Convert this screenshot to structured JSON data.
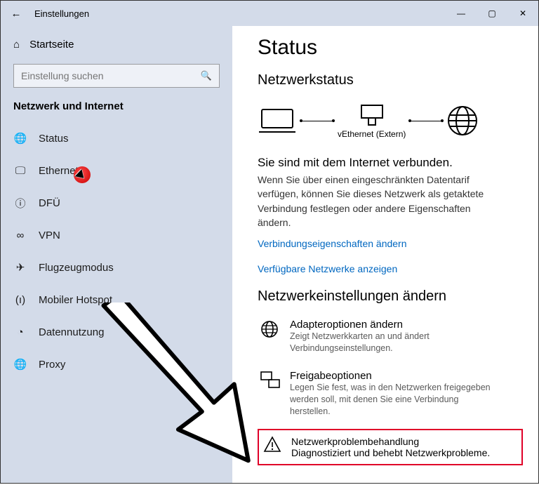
{
  "window": {
    "title": "Einstellungen"
  },
  "sidebar": {
    "home_label": "Startseite",
    "search_placeholder": "Einstellung suchen",
    "section": "Netzwerk und Internet",
    "items": [
      {
        "label": "Status"
      },
      {
        "label": "Ethernet"
      },
      {
        "label": "DFÜ"
      },
      {
        "label": "VPN"
      },
      {
        "label": "Flugzeugmodus"
      },
      {
        "label": "Mobiler Hotspot"
      },
      {
        "label": "Datennutzung"
      },
      {
        "label": "Proxy"
      }
    ]
  },
  "content": {
    "title": "Status",
    "section1": "Netzwerkstatus",
    "router_label": "vEthernet (Extern)",
    "connected": "Sie sind mit dem Internet verbunden.",
    "connected_sub": "Wenn Sie über einen eingeschränkten Datentarif verfügen, können Sie dieses Netzwerk als getaktete Verbindung festlegen oder andere Eigenschaften ändern.",
    "link1": "Verbindungseigenschaften ändern",
    "link2": "Verfügbare Netzwerke anzeigen",
    "section2": "Netzwerkeinstellungen ändern",
    "options": [
      {
        "title": "Adapteroptionen ändern",
        "desc": "Zeigt Netzwerkkarten an und ändert Verbindungseinstellungen."
      },
      {
        "title": "Freigabeoptionen",
        "desc": "Legen Sie fest, was in den Netzwerken freigegeben werden soll, mit denen Sie eine Verbindung herstellen."
      },
      {
        "title": "Netzwerkproblembehandlung",
        "desc": "Diagnostiziert und behebt Netzwerkprobleme."
      }
    ]
  }
}
